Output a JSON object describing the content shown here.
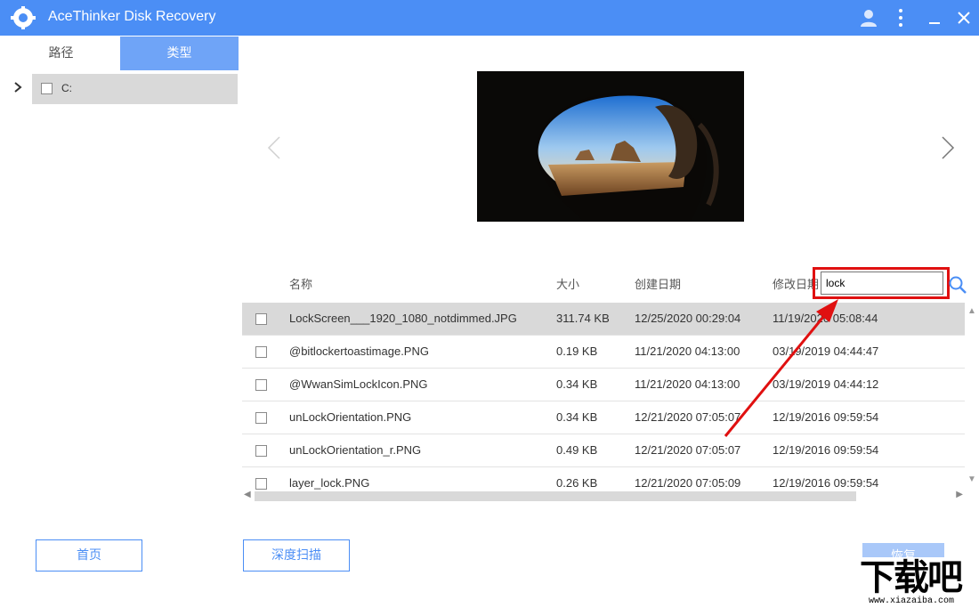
{
  "app": {
    "title": "AceThinker Disk Recovery"
  },
  "tabs": {
    "path": "路径",
    "type": "类型"
  },
  "tree": {
    "drive": "C:"
  },
  "table": {
    "headers": {
      "name": "名称",
      "size": "大小",
      "created": "创建日期",
      "modified": "修改日期"
    },
    "rows": [
      {
        "name": "LockScreen___1920_1080_notdimmed.JPG",
        "size": "311.74 KB",
        "created": "12/25/2020 00:29:04",
        "modified": "11/19/2020 05:08:44"
      },
      {
        "name": "@bitlockertoastimage.PNG",
        "size": "0.19 KB",
        "created": "11/21/2020 04:13:00",
        "modified": "03/19/2019 04:44:47"
      },
      {
        "name": "@WwanSimLockIcon.PNG",
        "size": "0.34 KB",
        "created": "11/21/2020 04:13:00",
        "modified": "03/19/2019 04:44:12"
      },
      {
        "name": "unLockOrientation.PNG",
        "size": "0.34 KB",
        "created": "12/21/2020 07:05:07",
        "modified": "12/19/2016 09:59:54"
      },
      {
        "name": "unLockOrientation_r.PNG",
        "size": "0.49 KB",
        "created": "12/21/2020 07:05:07",
        "modified": "12/19/2016 09:59:54"
      },
      {
        "name": "layer_lock.PNG",
        "size": "0.26 KB",
        "created": "12/21/2020 07:05:09",
        "modified": "12/19/2016 09:59:54"
      }
    ]
  },
  "search": {
    "value": "lock"
  },
  "buttons": {
    "home": "首页",
    "deep_scan": "深度扫描",
    "recover": "恢复"
  },
  "watermark": {
    "main": "下载吧",
    "sub": "www.xiazaiba.com"
  },
  "colors": {
    "accent": "#4b8ef5",
    "highlight": "#e01010",
    "selected_row": "#d9d9d9"
  }
}
